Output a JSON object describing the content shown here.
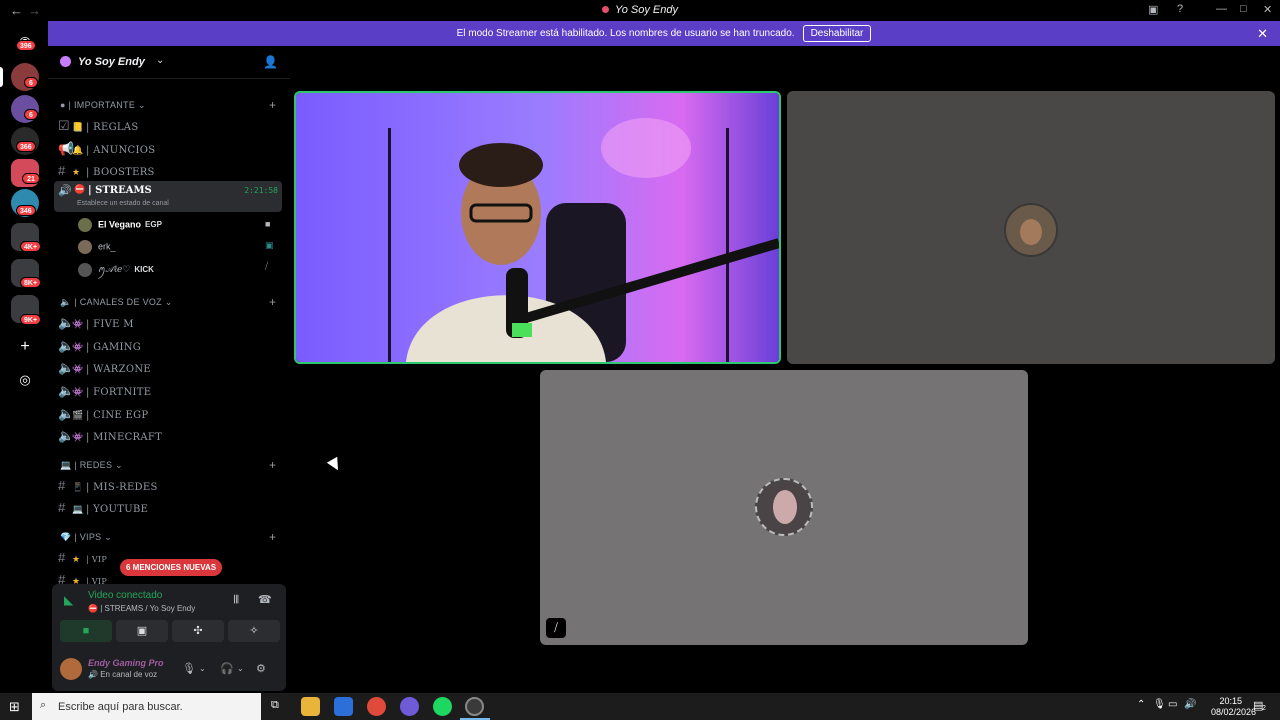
{
  "window": {
    "title": "Yo Soy Endy"
  },
  "banner": {
    "message": "El modo Streamer está habilitado. Los nombres de usuario se han truncado.",
    "button_label": "Deshabilitar"
  },
  "rail": {
    "badges": [
      "396",
      "6",
      "6",
      "366",
      "21",
      "346",
      "4K+",
      "8K+",
      "9K+"
    ]
  },
  "server": {
    "name": "Yo Soy Endy"
  },
  "categories": {
    "importante": "| IMPORTANTE",
    "voz": "| CANALES DE VOZ",
    "redes": "| REDES",
    "vips": "| VIPS"
  },
  "channels": {
    "reglas": "| REGLAS",
    "anuncios": "| ANUNCIOS",
    "boosters": "| BOOSTERS",
    "streams": "| STREAMS",
    "streams_timer": "2:21:58",
    "streams_status": "Establece un estado de canal",
    "fivem": "| FIVE M",
    "gaming": "| GAMING",
    "warzone": "| WARZONE",
    "fortnite": "| FORTNITE",
    "cine": "| CINE EGP",
    "minecraft": "| MINECRAFT",
    "misredes": "| MIS-REDES",
    "youtube": "| YOUTUBE",
    "vip1": "| VIP",
    "vip2": "| VIP"
  },
  "voice_users": [
    {
      "name": "El Vegano",
      "tag": "EGP"
    },
    {
      "name": "erk_",
      "tag": ""
    },
    {
      "name": "ꪑ𝒜ℓℯ♡",
      "tag": "KICK"
    }
  ],
  "mentions_pill": "6 MENCIONES NUEVAS",
  "voice_panel": {
    "status": "Video conectado",
    "channel": "| STREAMS / Yo Soy Endy"
  },
  "user": {
    "name": "Endy Gaming Pro",
    "status": "En canal de voz"
  },
  "taskbar": {
    "search_placeholder": "Escribe aquí para buscar.",
    "time": "20:15",
    "date": "08/02/2026",
    "notifications": "2"
  },
  "colors": {
    "banner": "#5b3ec6",
    "speaking_border": "#2dc770",
    "connected": "#23a55a",
    "badge": "#f23f43"
  },
  "icons": [
    "back-arrow-icon",
    "forward-arrow-icon",
    "inbox-icon",
    "help-icon",
    "minimize-icon",
    "maximize-icon",
    "close-icon",
    "add-server-icon",
    "discover-icon",
    "add-member-icon",
    "speaker-icon",
    "hash-icon",
    "gear-icon",
    "mic-icon",
    "headphones-icon",
    "camera-icon",
    "screen-share-icon",
    "activities-icon",
    "soundboard-icon",
    "disconnect-icon",
    "windows-start-icon",
    "search-icon"
  ]
}
